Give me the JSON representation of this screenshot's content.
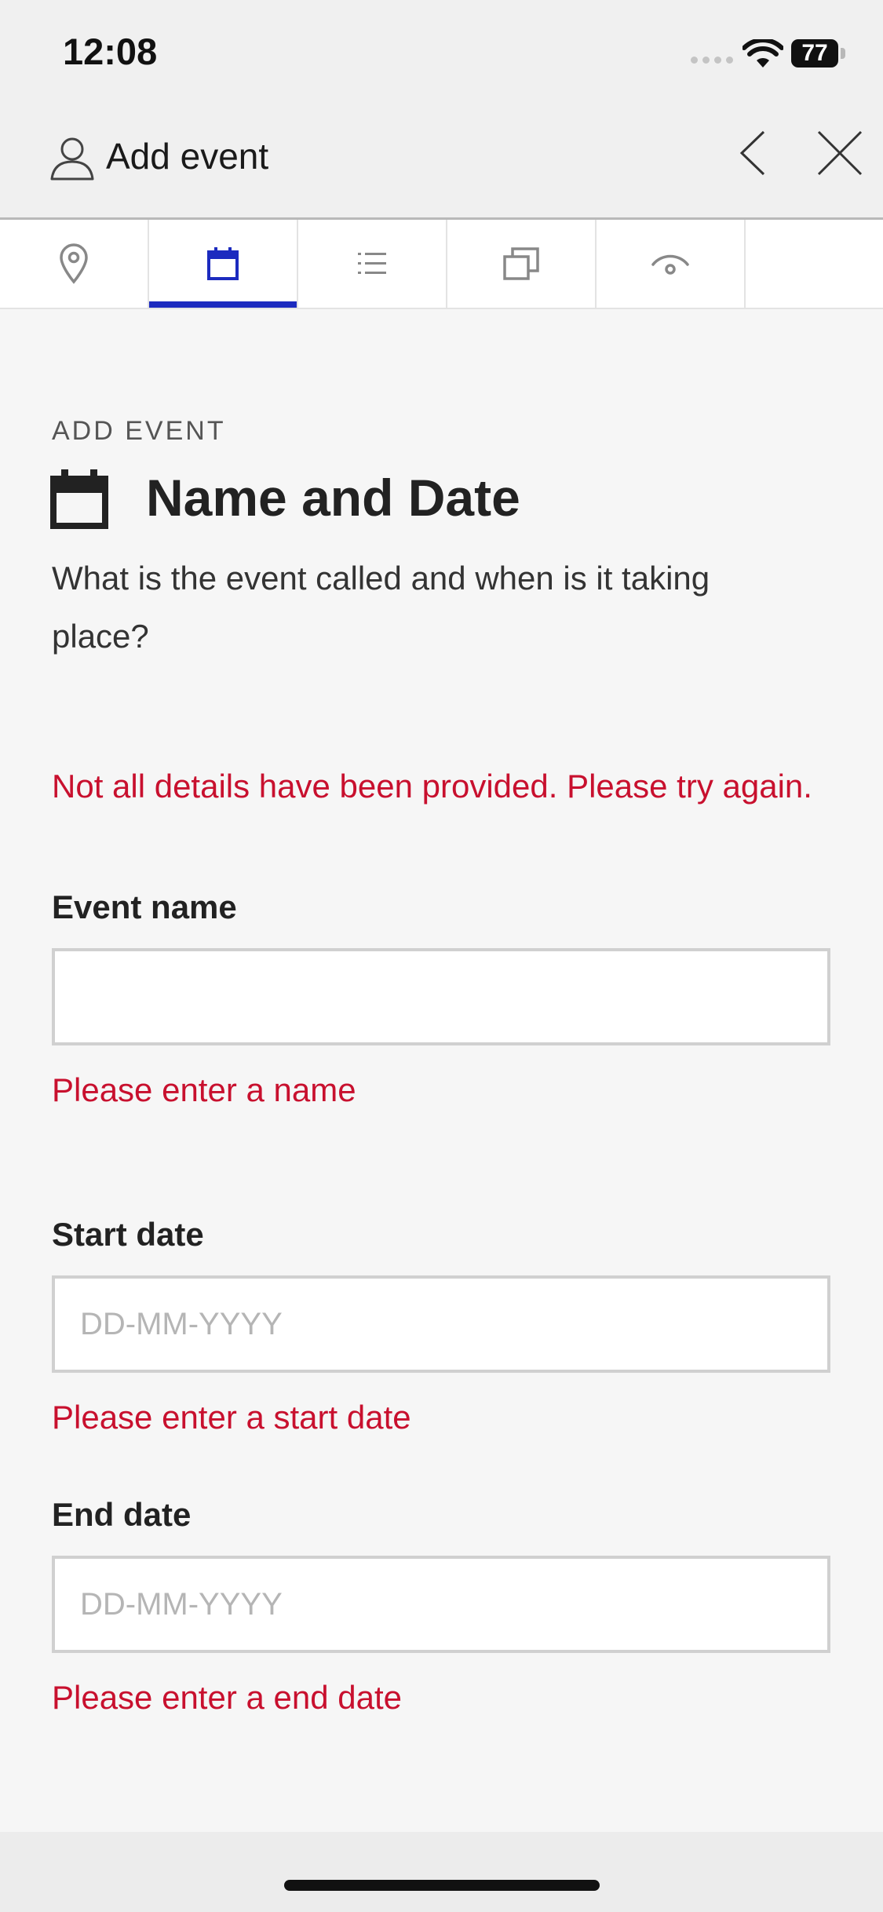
{
  "status_bar": {
    "time": "12:08",
    "battery": "77"
  },
  "header": {
    "title": "Add event"
  },
  "tabs": [
    {
      "name": "location",
      "icon": "map-pin-icon"
    },
    {
      "name": "date",
      "icon": "calendar-icon",
      "active": true
    },
    {
      "name": "details",
      "icon": "list-icon"
    },
    {
      "name": "media",
      "icon": "copy-icon"
    },
    {
      "name": "visibility",
      "icon": "visibility-icon"
    }
  ],
  "main": {
    "eyebrow": "ADD EVENT",
    "title": "Name and Date",
    "title_icon": "calendar-icon",
    "subtitle": "What is the event called and when is it taking place?",
    "form_error": "Not all details have been provided. Please try again."
  },
  "form": {
    "event_name": {
      "label": "Event name",
      "value": "",
      "placeholder": "",
      "error": "Please enter a name"
    },
    "start_date": {
      "label": "Start date",
      "value": "",
      "placeholder": "DD-MM-YYYY",
      "error": "Please enter a start date"
    },
    "end_date": {
      "label": "End date",
      "value": "",
      "placeholder": "DD-MM-YYYY",
      "error": "Please enter a end date"
    }
  },
  "colors": {
    "accent": "#1c2bbf",
    "error": "#c8102e",
    "background": "#f6f6f6",
    "header": "#f0f0f0"
  }
}
